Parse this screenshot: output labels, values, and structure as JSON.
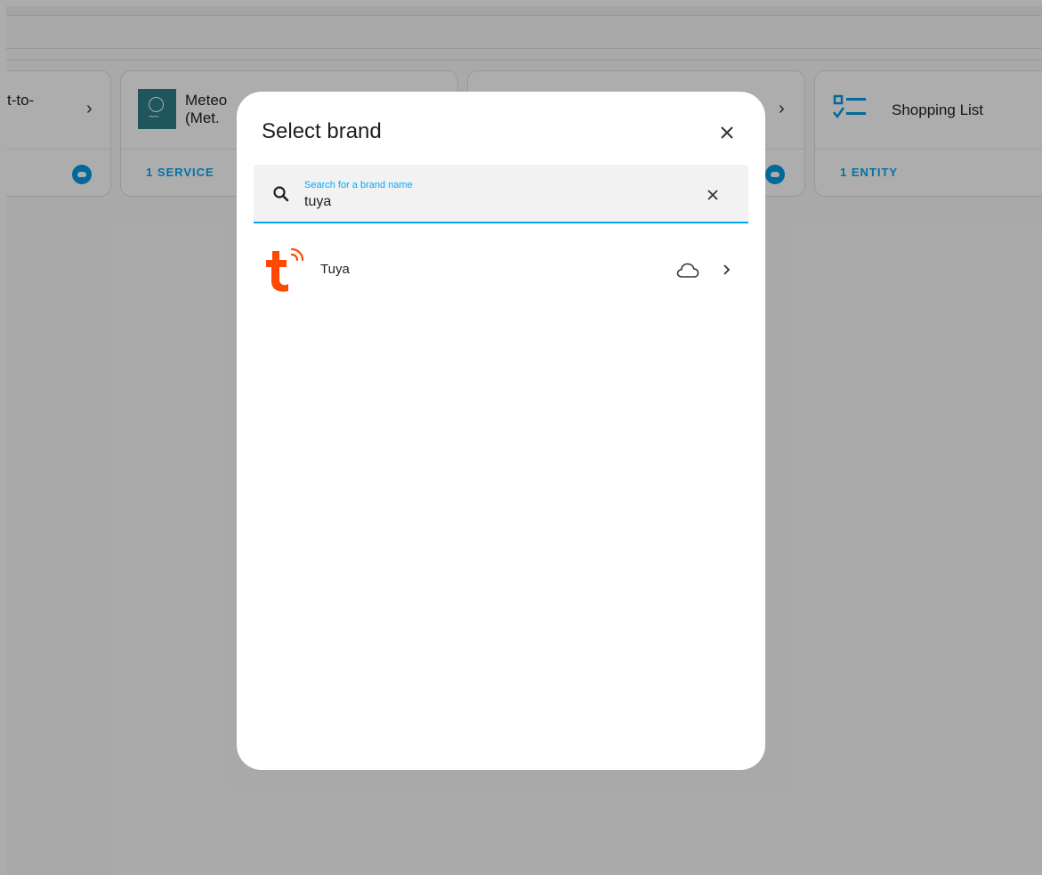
{
  "background": {
    "cards": [
      {
        "title": "t-to-",
        "footer": ""
      },
      {
        "title_line1": "Meteo",
        "title_line2": "(Met.",
        "footer": "1 SERVICE"
      },
      {
        "title": "",
        "footer": ""
      },
      {
        "title": "Shopping List",
        "footer": "1 ENTITY"
      }
    ]
  },
  "dialog": {
    "title": "Select brand",
    "search": {
      "label": "Search for a brand name",
      "value": "tuya"
    },
    "brands": [
      {
        "name": "Tuya",
        "cloud": true
      }
    ]
  },
  "colors": {
    "accent": "#03a9f4",
    "tuya_brand": "#ff4800",
    "scrim": "rgba(0,0,0,0.32)"
  }
}
